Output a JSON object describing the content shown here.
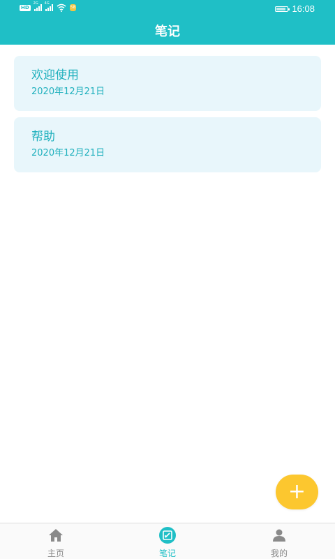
{
  "status_bar": {
    "hd_label": "HD",
    "signal1_label": "2G",
    "signal2_label": "4G",
    "badge": "58",
    "time": "16:08"
  },
  "header": {
    "title": "笔记"
  },
  "notes": [
    {
      "title": "欢迎使用",
      "date": "2020年12月21日"
    },
    {
      "title": "帮助",
      "date": "2020年12月21日"
    }
  ],
  "fab": {
    "icon": "plus-icon",
    "symbol": "+"
  },
  "tabbar": {
    "items": [
      {
        "label": "主页",
        "icon": "home-icon",
        "active": false
      },
      {
        "label": "笔记",
        "icon": "note-icon",
        "active": true
      },
      {
        "label": "我的",
        "icon": "user-icon",
        "active": false
      }
    ]
  },
  "colors": {
    "primary": "#1fbfc6",
    "card_bg": "#e8f6fb",
    "fab": "#fcc72f",
    "inactive_tab": "#8a8a8a"
  }
}
